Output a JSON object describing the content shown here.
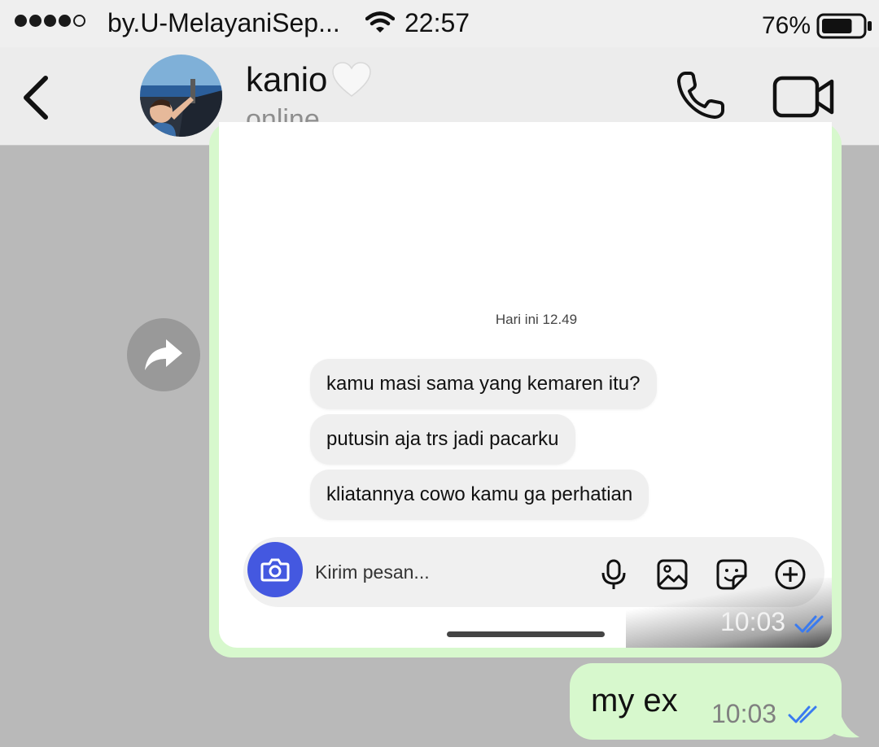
{
  "status_bar": {
    "signal_bars_filled": 4,
    "signal_bars_total": 5,
    "carrier": "by.U-MelayaniSep...",
    "time": "22:57",
    "battery_percent": "76%",
    "battery_level": 0.76
  },
  "header": {
    "contact_name": "kanio",
    "contact_status": "online",
    "icons": {
      "back": "chevron-left-icon",
      "heart": "white-heart-icon",
      "call": "phone-icon",
      "video": "video-camera-icon"
    }
  },
  "forward_icon": "forward-arrow-icon",
  "image_message": {
    "screenshot": {
      "day_stamp": "Hari ini 12.49",
      "messages": [
        "kamu masi sama yang kemaren itu?",
        "putusin aja trs jadi pacarku",
        "kliatannya cowo kamu ga perhatian"
      ],
      "compose_placeholder": "Kirim pesan...",
      "compose_icons": [
        "camera-icon",
        "microphone-icon",
        "gallery-icon",
        "sticker-icon",
        "plus-circle-icon"
      ]
    },
    "time": "10:03",
    "status_icon": "double-check-icon",
    "status_color": "#3a7bf0"
  },
  "text_message": {
    "text": "my ex",
    "time": "10:03",
    "status_icon": "double-check-icon",
    "status_color": "#3a7bf0"
  },
  "colors": {
    "chat_background": "#b9b9b9",
    "outgoing_bubble": "#d7f8cd",
    "header_background": "#ececec",
    "camera_button": "#4458e0"
  }
}
